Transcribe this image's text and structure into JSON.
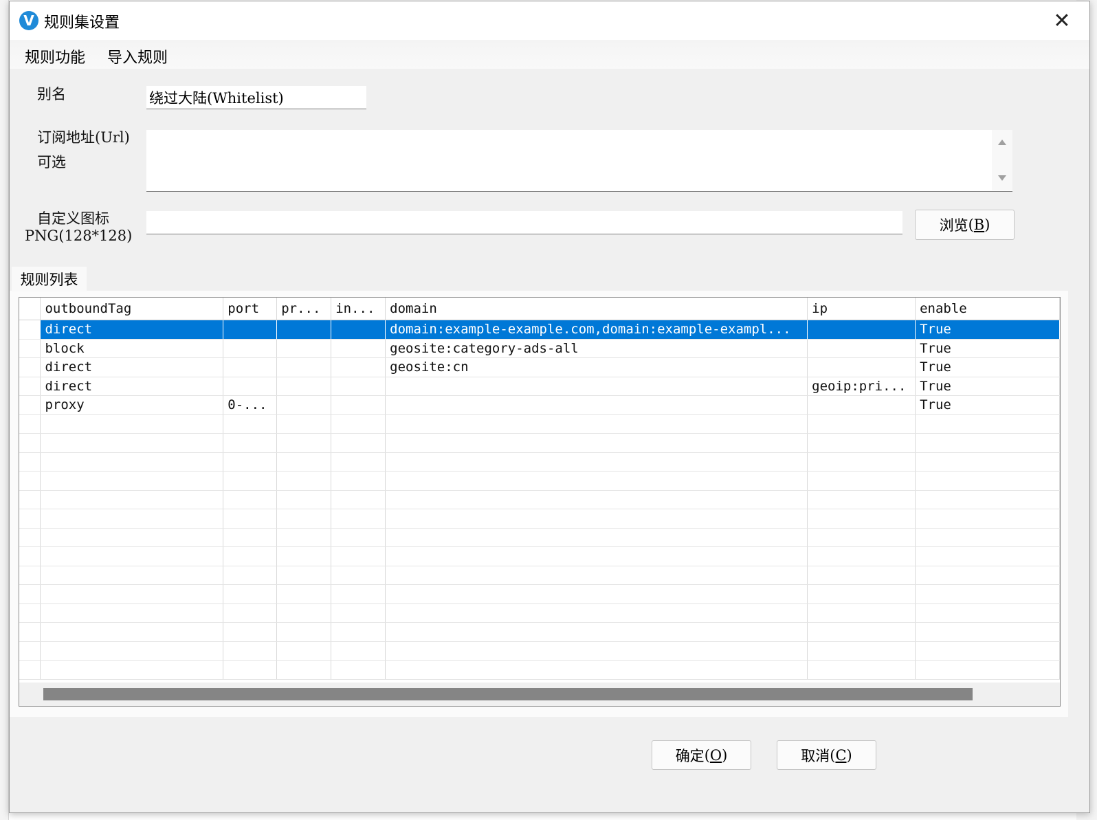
{
  "window": {
    "title": "规则集设置",
    "app_icon_letter": "V",
    "close_glyph": "✕"
  },
  "menu": {
    "items": [
      {
        "label": "规则功能"
      },
      {
        "label": "导入规则"
      }
    ]
  },
  "form": {
    "alias_label": "别名",
    "alias_value": "绕过大陆(Whitelist)",
    "url_label_line1": "订阅地址(Url)",
    "url_label_line2": "可选",
    "url_value": "",
    "icon_label_line1": "自定义图标",
    "icon_label_line2": "PNG(128*128)",
    "icon_value": "",
    "browse_label": "浏览",
    "browse_mnemonic": "B"
  },
  "tab": {
    "label": "规则列表"
  },
  "grid": {
    "columns": [
      "outboundTag",
      "port",
      "pr...",
      "in...",
      "domain",
      "ip",
      "enable"
    ],
    "rows": [
      [
        "direct",
        "",
        "",
        "",
        "domain:example-example.com,domain:example-exampl...",
        "",
        "True"
      ],
      [
        "block",
        "",
        "",
        "",
        "geosite:category-ads-all",
        "",
        "True"
      ],
      [
        "direct",
        "",
        "",
        "",
        "geosite:cn",
        "",
        "True"
      ],
      [
        "direct",
        "",
        "",
        "",
        "",
        "geoip:pri...",
        "True"
      ],
      [
        "proxy",
        "0-...",
        "",
        "",
        "",
        "",
        "True"
      ]
    ],
    "selected_row": 0,
    "empty_rows": 14
  },
  "buttons": {
    "ok_label": "确定",
    "ok_mnemonic": "O",
    "cancel_label": "取消",
    "cancel_mnemonic": "C"
  },
  "colors": {
    "selection": "#0078d7",
    "icon_blue": "#1f8ad8",
    "window_bg": "#f0f0f0"
  }
}
